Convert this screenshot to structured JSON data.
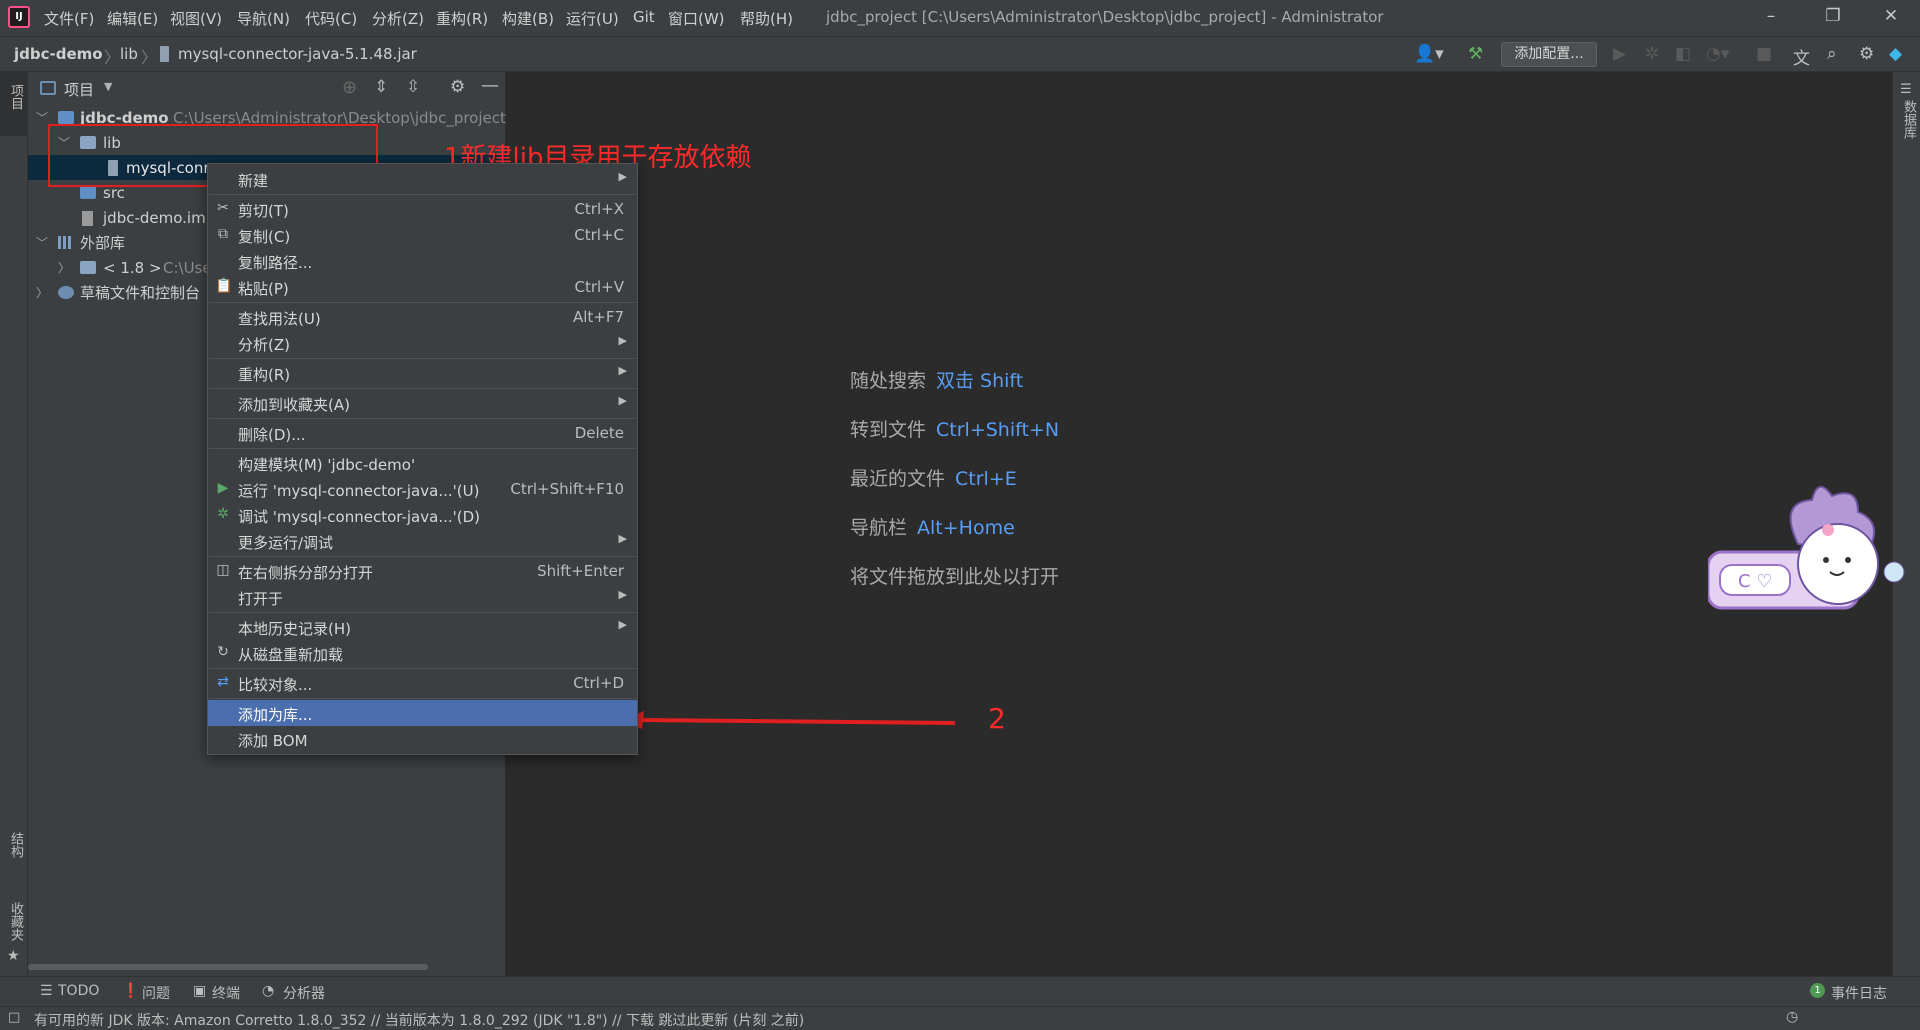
{
  "menu": {
    "items": [
      "文件(F)",
      "编辑(E)",
      "视图(V)",
      "导航(N)",
      "代码(C)",
      "分析(Z)",
      "重构(R)",
      "构建(B)",
      "运行(U)",
      "Git",
      "窗口(W)",
      "帮助(H)"
    ]
  },
  "window_title": "jdbc_project [C:\\Users\\Administrator\\Desktop\\jdbc_project] - Administrator",
  "breadcrumb": [
    "jdbc-demo",
    "lib",
    "mysql-connector-java-5.1.48.jar"
  ],
  "toolbar": {
    "add_config_label": "添加配置..."
  },
  "left_strip": {
    "project_label": "项目",
    "structure_label": "结构",
    "favorites_label": "收藏夹"
  },
  "right_strip": {
    "database_label": "数据库"
  },
  "project_panel": {
    "title": "项目",
    "tree": {
      "root_name": "jdbc-demo",
      "root_path": "C:\\Users\\Administrator\\Desktop\\jdbc_project\\",
      "lib": "lib",
      "jar": "mysql-conn",
      "src": "src",
      "iml": "jdbc-demo.im",
      "external_libs": "外部库",
      "jdk": "< 1.8 >",
      "jdk_path": "C:\\Use",
      "scratches": "草稿文件和控制台"
    }
  },
  "annotations": {
    "note1": "1新建lib目录用于存放依赖",
    "note2": "2"
  },
  "context_menu": {
    "items": [
      {
        "label": "新建",
        "shortcut": "",
        "submenu": true
      },
      {
        "label": "剪切(T)",
        "shortcut": "Ctrl+X"
      },
      {
        "label": "复制(C)",
        "shortcut": "Ctrl+C"
      },
      {
        "label": "复制路径...",
        "shortcut": ""
      },
      {
        "label": "粘贴(P)",
        "shortcut": "Ctrl+V"
      },
      {
        "label": "查找用法(U)",
        "shortcut": "Alt+F7"
      },
      {
        "label": "分析(Z)",
        "shortcut": "",
        "submenu": true
      },
      {
        "label": "重构(R)",
        "shortcut": "",
        "submenu": true
      },
      {
        "label": "添加到收藏夹(A)",
        "shortcut": "",
        "submenu": true
      },
      {
        "label": "删除(D)...",
        "shortcut": "Delete"
      },
      {
        "label": "构建模块(M) 'jdbc-demo'",
        "shortcut": ""
      },
      {
        "label": "运行 'mysql-connector-java...'(U)",
        "shortcut": "Ctrl+Shift+F10"
      },
      {
        "label": "调试 'mysql-connector-java...'(D)",
        "shortcut": ""
      },
      {
        "label": "更多运行/调试",
        "shortcut": "",
        "submenu": true
      },
      {
        "label": "在右侧拆分部分打开",
        "shortcut": "Shift+Enter"
      },
      {
        "label": "打开于",
        "shortcut": "",
        "submenu": true
      },
      {
        "label": "本地历史记录(H)",
        "shortcut": "",
        "submenu": true
      },
      {
        "label": "从磁盘重新加载",
        "shortcut": ""
      },
      {
        "label": "比较对象...",
        "shortcut": "Ctrl+D"
      },
      {
        "label": "添加为库...",
        "shortcut": ""
      },
      {
        "label": "添加 BOM",
        "shortcut": ""
      }
    ]
  },
  "editor_hints": [
    {
      "label": "随处搜索",
      "key": "双击 Shift"
    },
    {
      "label": "转到文件",
      "key": "Ctrl+Shift+N"
    },
    {
      "label": "最近的文件",
      "key": "Ctrl+E"
    },
    {
      "label": "导航栏",
      "key": "Alt+Home"
    },
    {
      "label": "将文件拖放到此处以打开",
      "key": ""
    }
  ],
  "bottom_tabs": [
    "TODO",
    "问题",
    "终端",
    "分析器"
  ],
  "event_log": {
    "count": "1",
    "label": "事件日志"
  },
  "status": {
    "message": "有可用的新 JDK 版本: Amazon Corretto 1.8.0_352 // 当前版本为 1.8.0_292 (JDK \"1.8\") // 下载   跳过此更新 (片刻 之前)"
  },
  "colors": {
    "accent": "#4b6eaf",
    "link": "#589df6",
    "annotation": "#e02020",
    "background": "#2b2b2b",
    "panel": "#3c3f41"
  }
}
